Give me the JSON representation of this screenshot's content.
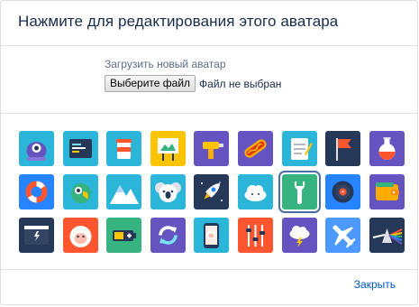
{
  "dialog": {
    "title": "Нажмите для редактирования этого аватара",
    "upload_label": "Загрузить новый аватар",
    "choose_file_label": "Выберите файл",
    "file_status": "Файл не выбран",
    "close_label": "Закрыть"
  },
  "avatars": [
    {
      "name": "alien-avatar",
      "bg": "#2bb5d8"
    },
    {
      "name": "code-editor-avatar",
      "bg": "#2bb5d8"
    },
    {
      "name": "coffee-cup-avatar",
      "bg": "#2bb5d8"
    },
    {
      "name": "easel-avatar",
      "bg": "#ffc400"
    },
    {
      "name": "drill-avatar",
      "bg": "#6554c0"
    },
    {
      "name": "hotdog-avatar",
      "bg": "#6554c0"
    },
    {
      "name": "notepad-avatar",
      "bg": "#2bb5d8"
    },
    {
      "name": "red-flag-avatar",
      "bg": "#253858"
    },
    {
      "name": "potion-avatar",
      "bg": "#6554c0"
    },
    {
      "name": "lifebuoy-avatar",
      "bg": "#2684ff"
    },
    {
      "name": "parrot-avatar",
      "bg": "#2bb5d8"
    },
    {
      "name": "mountains-avatar",
      "bg": "#2bb5d8"
    },
    {
      "name": "koala-avatar",
      "bg": "#2bb5d8"
    },
    {
      "name": "rocket-avatar",
      "bg": "#253858"
    },
    {
      "name": "cloud-avatar",
      "bg": "#2bb5d8"
    },
    {
      "name": "wrench-avatar",
      "bg": "#36b37e"
    },
    {
      "name": "vinyl-record-avatar",
      "bg": "#2684ff"
    },
    {
      "name": "wallet-avatar",
      "bg": "#6554c0"
    },
    {
      "name": "browser-window-avatar",
      "bg": "#253858"
    },
    {
      "name": "yeti-avatar",
      "bg": "#ff5630"
    },
    {
      "name": "battery-avatar",
      "bg": "#36b37e"
    },
    {
      "name": "refresh-avatar",
      "bg": "#6554c0"
    },
    {
      "name": "phone-yeti-avatar",
      "bg": "#2bb5d8"
    },
    {
      "name": "sliders-avatar",
      "bg": "#ff5630"
    },
    {
      "name": "storm-cloud-avatar",
      "bg": "#6554c0"
    },
    {
      "name": "airplane-avatar",
      "bg": "#4c9aff"
    },
    {
      "name": "prism-avatar",
      "bg": "#253858"
    }
  ],
  "selected_avatar": "wrench-avatar"
}
